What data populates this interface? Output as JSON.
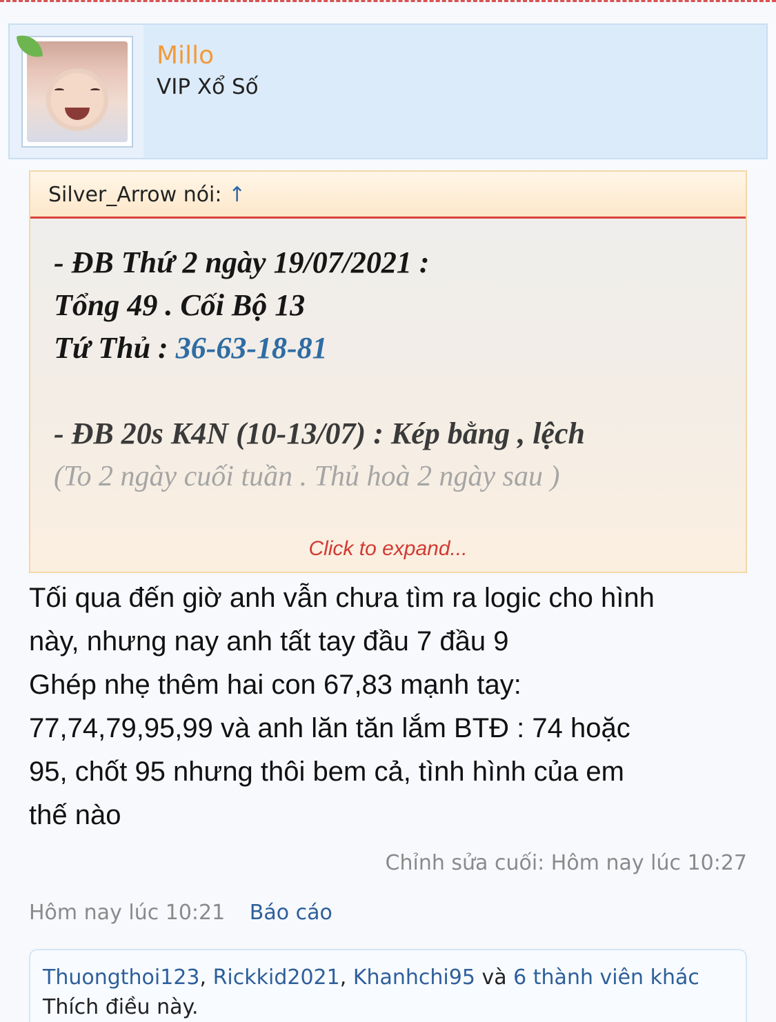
{
  "user": {
    "name": "Millo",
    "title": "VIP Xổ Số"
  },
  "quote": {
    "author_label": "Silver_Arrow nói:",
    "arrow": "↑",
    "line1": "- ĐB Thứ 2 ngày 19/07/2021 :",
    "line2": "Tổng 49 . Cối Bộ 13",
    "line3_prefix": "Tứ Thủ : ",
    "line3_link": "36-63-18-81",
    "line4": "- ĐB 20s K4N (10-13/07) : Kép bằng , lệch",
    "line5": "(To 2 ngày cuối tuần . Thủ hoà 2 ngày sau )",
    "expand_label": "Click to expand..."
  },
  "message": {
    "lines": [
      "Tối qua đến giờ anh vẫn chưa tìm ra logic cho hình",
      "này, nhưng nay anh tất tay đầu 7 đầu 9",
      "Ghép nhẹ thêm hai con 67,83 mạnh tay:",
      "77,74,79,95,99 và anh lăn tăn lắm BTĐ : 74 hoặc",
      "95, chốt 95 nhưng thôi bem cả, tình hình của em",
      "thế nào"
    ]
  },
  "edited": "Chỉnh sửa cuối: Hôm nay lúc 10:27",
  "meta": {
    "time": "Hôm nay lúc 10:21",
    "report": "Báo cáo"
  },
  "likes": {
    "user1": "Thuongthoi123",
    "user2": "Rickkid2021",
    "user3": "Khanhchi95",
    "sep": ", ",
    "and": " và ",
    "others": "6 thành viên khác",
    "suffix": "Thích điều này."
  }
}
